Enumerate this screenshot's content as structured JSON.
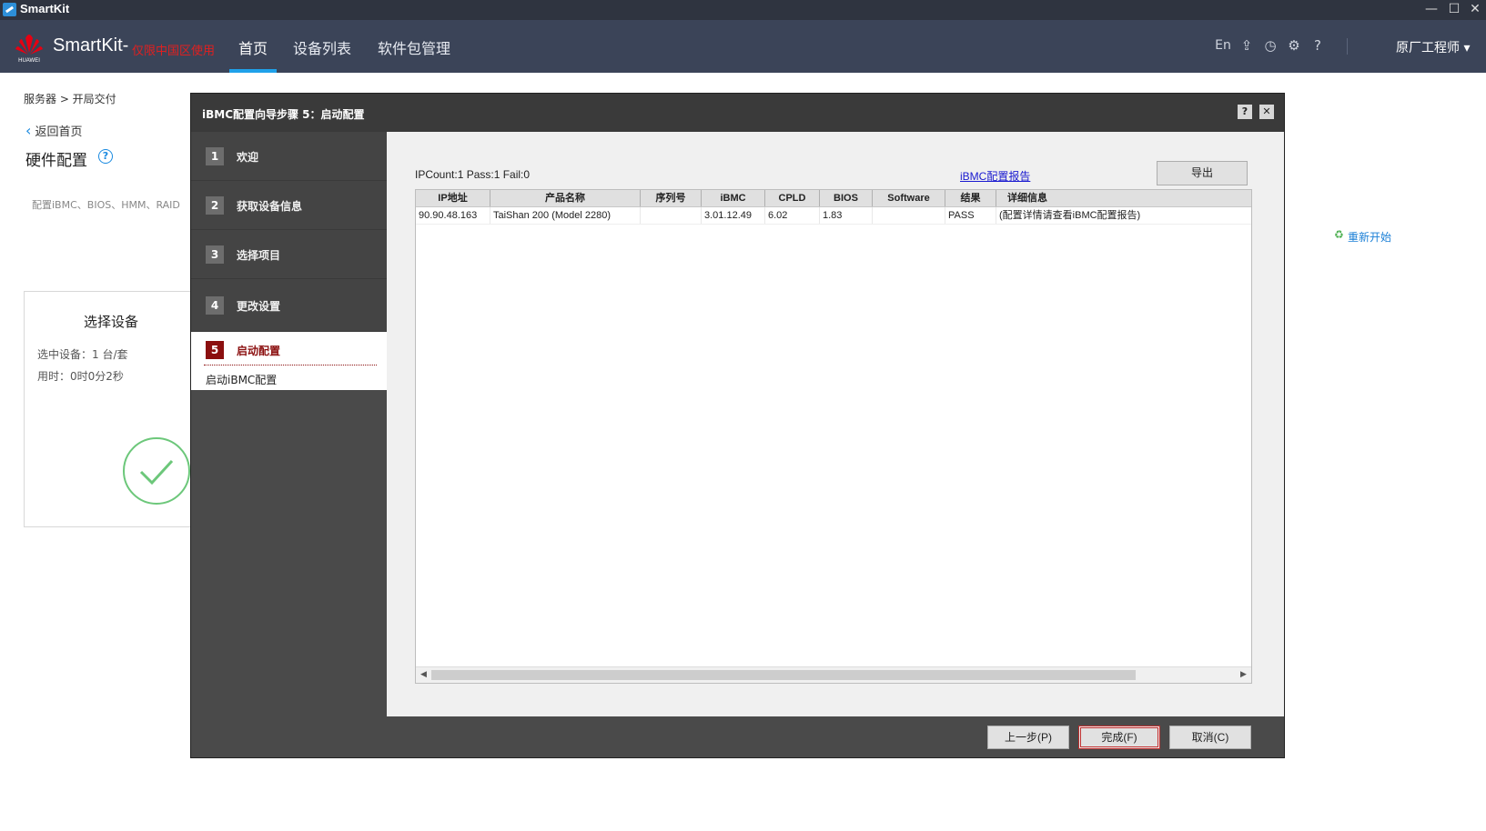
{
  "window": {
    "title": "SmartKit",
    "controls": [
      "—",
      "☐",
      "✕"
    ]
  },
  "header": {
    "brand_name": "SmartKit-",
    "brand_sub": "仅限中国区使用",
    "logo_text": "HUAWEI",
    "nav": [
      "首页",
      "设备列表",
      "软件包管理"
    ],
    "lang": "En",
    "user": "原厂工程师 ▾",
    "icons": [
      "upload-icon",
      "history-icon",
      "gear-icon",
      "help-icon"
    ]
  },
  "page": {
    "breadcrumb": "服务器 > 开局交付",
    "back": "返回首页",
    "title": "硬件配置",
    "description": "配置iBMC、BIOS、HMM、RAID",
    "card": {
      "title": "选择设备",
      "selected": "选中设备：1 台/套",
      "elapsed": "用时：0时0分2秒"
    },
    "restart": "重新开始"
  },
  "dialog": {
    "title": "iBMC配置向导步骤 5：启动配置",
    "steps": [
      {
        "num": "1",
        "label": "欢迎"
      },
      {
        "num": "2",
        "label": "获取设备信息"
      },
      {
        "num": "3",
        "label": "选择项目"
      },
      {
        "num": "4",
        "label": "更改设置"
      },
      {
        "num": "5",
        "label": "启动配置",
        "sub": "启动iBMC配置"
      }
    ],
    "stats": "IPCount:1  Pass:1  Fail:0",
    "report_link": "iBMC配置报告",
    "export_label": "导出",
    "columns": [
      "IP地址",
      "产品名称",
      "序列号",
      "iBMC",
      "CPLD",
      "BIOS",
      "Software",
      "结果",
      "详细信息"
    ],
    "rows": [
      [
        "90.90.48.163",
        "TaiShan 200 (Model 2280)",
        "",
        "3.01.12.49",
        "6.02",
        "1.83",
        "",
        "PASS",
        "(配置详情请查看iBMC配置报告)"
      ]
    ],
    "buttons": {
      "prev": "上一步(P)",
      "finish": "完成(F)",
      "cancel": "取消(C)"
    }
  }
}
